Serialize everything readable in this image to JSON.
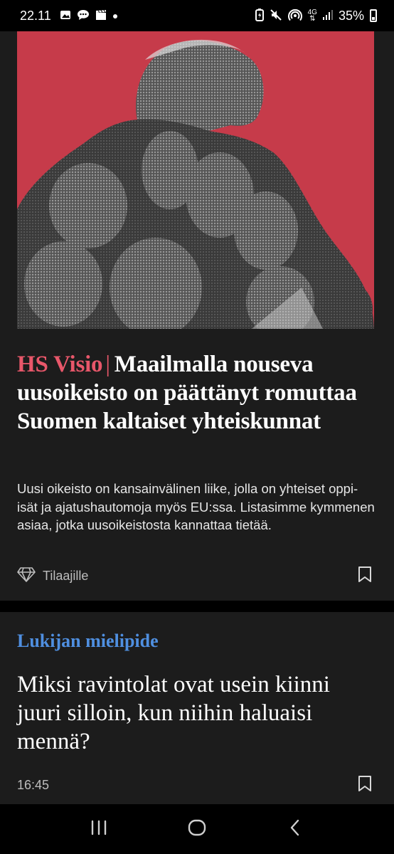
{
  "status_bar": {
    "time": "22.11",
    "battery": "35%",
    "network": "4G",
    "left_icons": [
      "image-icon",
      "message-icon",
      "clapperboard-icon",
      "dot-icon"
    ],
    "right_icons": [
      "battery-saver-icon",
      "mute-icon",
      "hotspot-icon",
      "signal-icon"
    ]
  },
  "article_1": {
    "hero_alt_icon": "collage-image",
    "kicker": "HS Visio",
    "separator": "|",
    "headline": "Maailmalla nouseva uusoikeisto on päättänyt romuttaa Suomen kaltaiset yhteiskunnat",
    "lead": "Uusi oikeisto on kansainvälinen liike, jolla on yhteiset oppi-isät ja ajatushautomoja myös EU:ssa. Listasimme kymmenen asiaa, jotka uusoikeistosta kannattaa tietää.",
    "subscriber_label": "Tilaajille",
    "subscriber_icon": "diamond-icon",
    "bookmark_icon": "bookmark-icon"
  },
  "article_2": {
    "kicker": "Lukijan mielipide",
    "headline": "Miksi ravintolat ovat usein kiinni juuri silloin, kun niihin haluaisi mennä?",
    "time": "16:45",
    "bookmark_icon": "bookmark-icon"
  },
  "nav_bar": {
    "recents_icon": "recents-icon",
    "home_icon": "home-icon",
    "back_icon": "back-icon"
  },
  "colors": {
    "hero_background": "#c63b4a",
    "kicker_red": "#e8576a",
    "kicker_blue": "#4f8fe0",
    "card_background": "#1c1c1c"
  }
}
